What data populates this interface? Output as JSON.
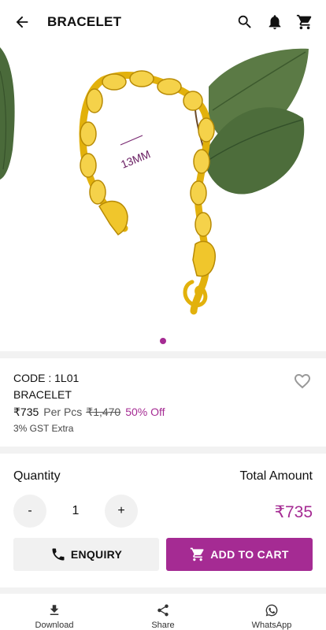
{
  "appbar": {
    "title": "BRACELET",
    "icons": [
      "arrow-back-icon",
      "search-icon",
      "bell-icon",
      "cart-icon"
    ]
  },
  "carousel": {
    "image_label": "13MM",
    "page_count": 1,
    "active_index": 0,
    "accent": "#a52b93"
  },
  "product": {
    "code": "CODE : 1L01",
    "name": "BRACELET",
    "price": "₹735",
    "per_unit": "Per Pcs",
    "mrp": "₹1,470",
    "discount": "50% Off",
    "tax_note": "3% GST Extra"
  },
  "order": {
    "quantity_label": "Quantity",
    "total_label": "Total Amount",
    "decrement": "-",
    "quantity": "1",
    "increment": "+",
    "total": "₹735",
    "enquiry_label": "ENQUIRY",
    "add_to_cart_label": "ADD TO CART"
  },
  "bottom_bar": {
    "items": [
      {
        "label": "Download",
        "icon": "download-icon"
      },
      {
        "label": "Share",
        "icon": "share-icon"
      },
      {
        "label": "WhatsApp",
        "icon": "whatsapp-icon"
      }
    ]
  },
  "colors": {
    "accent": "#a52b93",
    "gold": "#e8b80f",
    "leaf": "#4a6a3a"
  }
}
